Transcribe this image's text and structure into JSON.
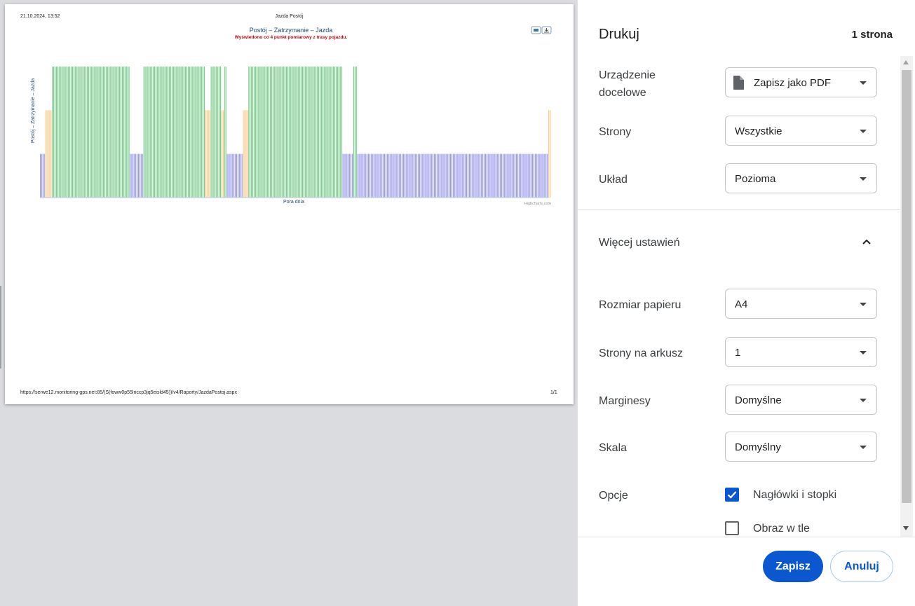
{
  "preview": {
    "header_left": "21.10.2024, 13:52",
    "header_center": "Jazda Postój",
    "footer_left": "https://serwe12.monitoring-gps.net:85/(S(foww0p55lnccp3jq5eisld45))/v4/Raporty/JazdaPostoj.aspx",
    "footer_right": "1/1"
  },
  "chart_data": {
    "type": "bar",
    "title": "Postój – Zatrzymanie – Jazda",
    "subtitle": "Wyświetlono co 4 punkt pomiarowy z trasy pojazdu.",
    "xlabel": "Pora dnia",
    "ylabel": "Postój – Zatrzymanie – Jazda",
    "credits": "Highcharts.com",
    "ylim": [
      0,
      3
    ],
    "state_colors": {
      "1": "#8f8fe6",
      "2": "#f5c98a",
      "3": "#6cc47f"
    },
    "state_runs": [
      [
        1,
        4
      ],
      [
        2,
        5
      ],
      [
        3,
        58
      ],
      [
        1,
        10
      ],
      [
        3,
        46
      ],
      [
        2,
        4
      ],
      [
        3,
        8
      ],
      [
        2,
        2
      ],
      [
        3,
        2
      ],
      [
        1,
        12
      ],
      [
        2,
        4
      ],
      [
        3,
        70
      ],
      [
        1,
        8
      ],
      [
        3,
        3
      ],
      [
        1,
        142
      ],
      [
        2,
        2
      ]
    ],
    "icons": [
      "print-icon",
      "download-icon"
    ]
  },
  "panel": {
    "title": "Drukuj",
    "page_count": "1 strona",
    "destination_label": "Urządzenie docelowe",
    "destination_value": "Zapisz jako PDF",
    "pages_label": "Strony",
    "pages_value": "Wszystkie",
    "layout_label": "Układ",
    "layout_value": "Pozioma",
    "more_settings": "Więcej ustawień",
    "paper_label": "Rozmiar papieru",
    "paper_value": "A4",
    "per_sheet_label": "Strony na arkusz",
    "per_sheet_value": "1",
    "margins_label": "Marginesy",
    "margins_value": "Domyślne",
    "scale_label": "Skala",
    "scale_value": "Domyślny",
    "options_label": "Opcje",
    "option_headers": "Nagłówki i stopki",
    "option_headers_checked": true,
    "option_background": "Obraz w tle",
    "option_background_checked": false,
    "save_button": "Zapisz",
    "cancel_button": "Anuluj"
  }
}
